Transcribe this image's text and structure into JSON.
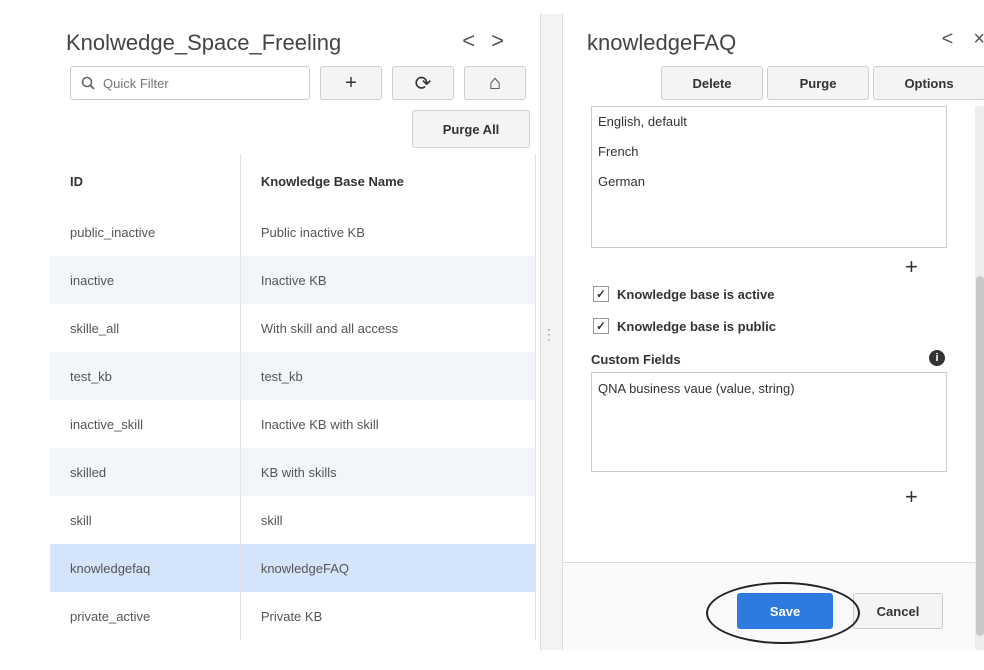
{
  "left": {
    "title": "Knolwedge_Space_Freeling",
    "back_glyph": "<",
    "forward_glyph": ">",
    "search_placeholder": "Quick Filter",
    "add_glyph": "+",
    "refresh_glyph": "⟳",
    "bank_glyph": "⌂",
    "purge_all_label": "Purge All",
    "table": {
      "headers": [
        "ID",
        "Knowledge Base Name"
      ],
      "rows": [
        [
          "public_inactive",
          "Public inactive KB"
        ],
        [
          "inactive",
          "Inactive KB"
        ],
        [
          "skille_all",
          "With skill and all access"
        ],
        [
          "test_kb",
          "test_kb"
        ],
        [
          "inactive_skill",
          "Inactive KB with skill"
        ],
        [
          "skilled",
          "KB with skills"
        ],
        [
          "skill",
          "skill"
        ],
        [
          "knowledgefaq",
          "knowledgeFAQ"
        ],
        [
          "private_active",
          "Private KB"
        ]
      ],
      "selected_row": 7
    }
  },
  "right": {
    "title": "knowledgeFAQ",
    "back_glyph": "<",
    "close_glyph": "×",
    "delete_label": "Delete",
    "purge_label": "Purge",
    "options_label": "Options",
    "languages": [
      "English, default",
      "French",
      "German"
    ],
    "add_glyph": "+",
    "active_label": "Knowledge base is active",
    "public_label": "Knowledge base is public",
    "custom_fields_label": "Custom Fields",
    "info_glyph": "i",
    "custom_field_value": "QNA business vaue (value, string)",
    "save_label": "Save",
    "cancel_label": "Cancel"
  },
  "colors": {
    "accent": "#2e7be0",
    "selected_row": "#d4e4fa",
    "alt_row": "#f2f5f9"
  }
}
